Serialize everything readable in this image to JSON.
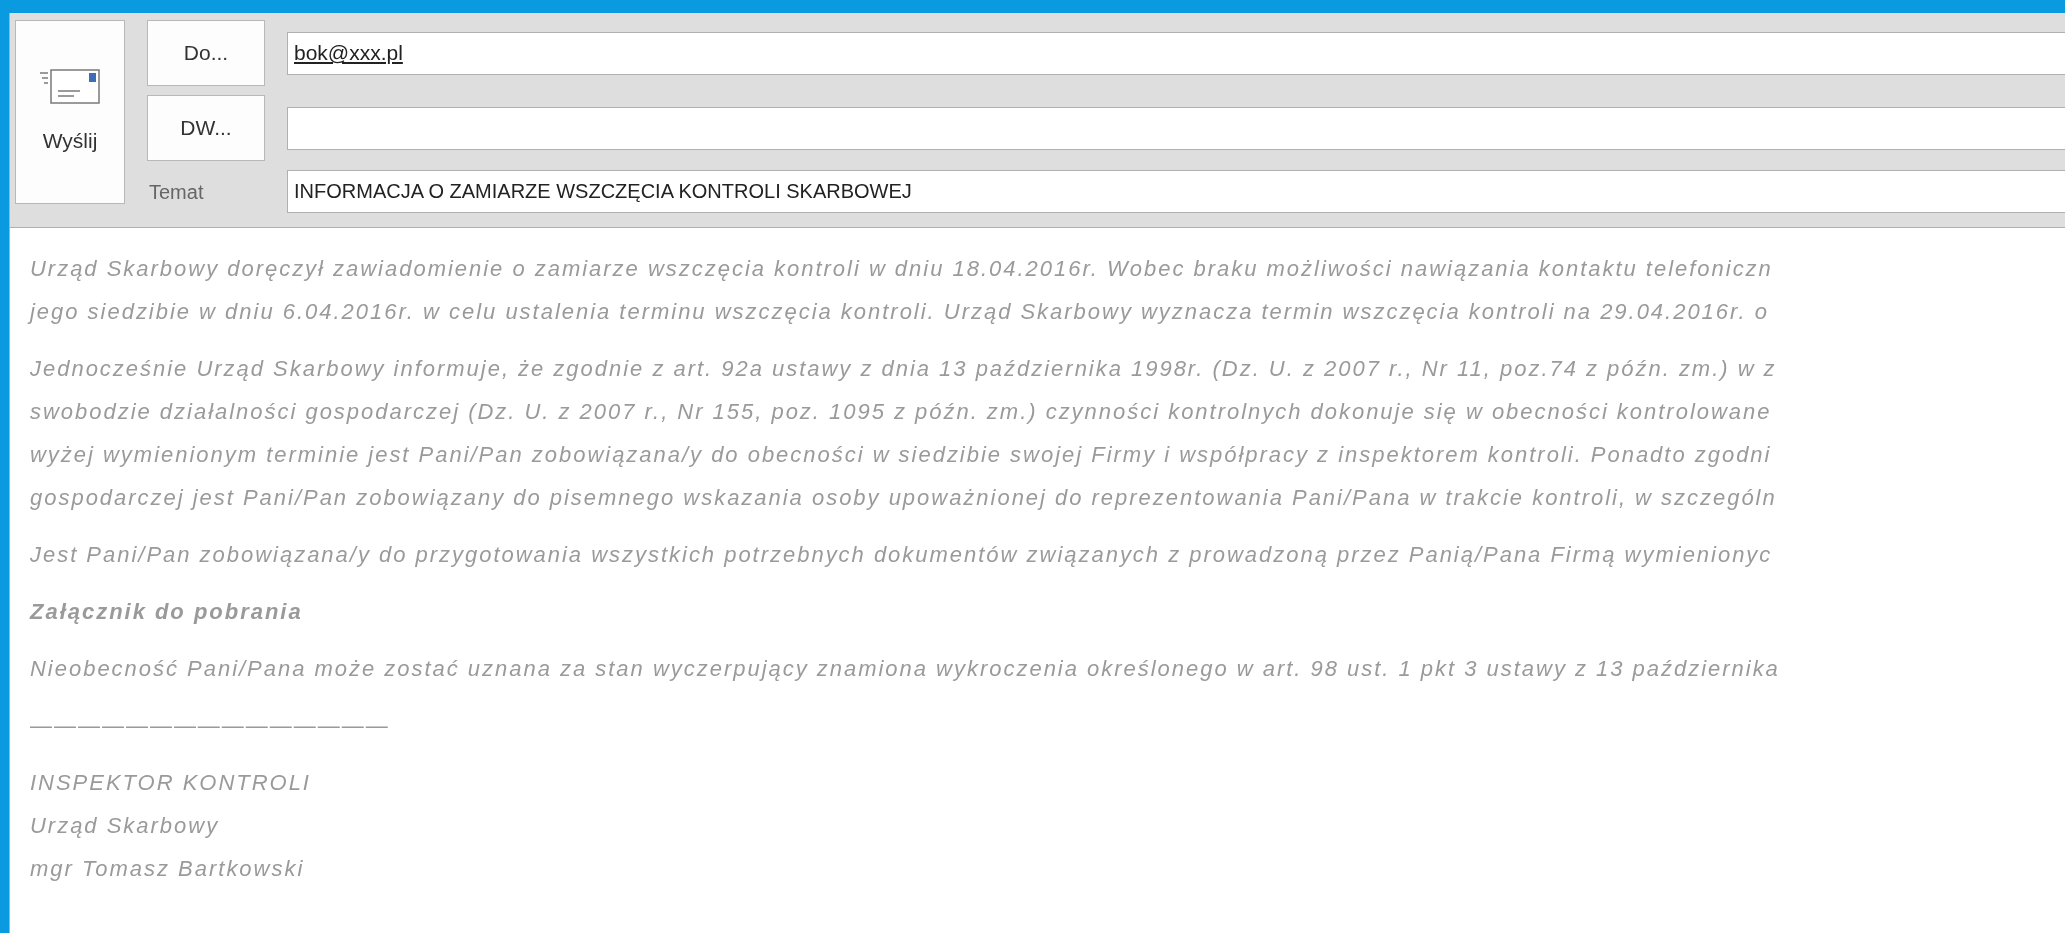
{
  "send_button": {
    "label": "Wyślij"
  },
  "to": {
    "label": "Do...",
    "value": "bok@xxx.pl"
  },
  "cc": {
    "label": "DW..."
  },
  "subject": {
    "label": "Temat",
    "value": "INFORMACJA O ZAMIARZE WSZCZĘCIA KONTROLI SKARBOWEJ"
  },
  "body": [
    {
      "kind": "paragraph",
      "lines": [
        "Urząd Skarbowy doręczył zawiadomienie o zamiarze wszczęcia kontroli w dniu 18.04.2016r. Wobec braku możliwości nawiązania kontaktu telefoniczn",
        "jego siedzibie w dniu 6.04.2016r. w celu ustalenia terminu wszczęcia kontroli. Urząd Skarbowy wyznacza termin wszczęcia kontroli na 29.04.2016r. o"
      ]
    },
    {
      "kind": "paragraph",
      "lines": [
        "Jednocześnie Urząd Skarbowy informuje, że zgodnie z art. 92a ustawy z dnia 13 października 1998r. (Dz. U. z 2007 r., Nr 11, poz.74 z późn. zm.) w z",
        "swobodzie działalności gospodarczej (Dz. U. z 2007 r., Nr 155, poz. 1095 z późn. zm.) czynności kontrolnych dokonuje się w obecności kontrolowane",
        "wyżej wymienionym terminie jest Pani/Pan zobowiązana/y do obecności w siedzibie swojej Firmy i współpracy z inspektorem kontroli. Ponadto zgodni",
        "gospodarczej jest Pani/Pan zobowiązany do pisemnego wskazania osoby upoważnionej do reprezentowania Pani/Pana w trakcie kontroli, w szczególn"
      ]
    },
    {
      "kind": "paragraph",
      "lines": [
        "Jest Pani/Pan zobowiązana/y do przygotowania wszystkich potrzebnych dokumentów związanych z prowadzoną przez Panią/Pana Firmą wymienionyc"
      ]
    },
    {
      "kind": "heading",
      "lines": [
        "Załącznik do pobrania"
      ]
    },
    {
      "kind": "paragraph",
      "lines": [
        "Nieobecność Pani/Pana może zostać uznana za stan wyczerpujący znamiona wykroczenia określonego w art. 98 ust. 1 pkt 3 ustawy z 13 października"
      ]
    },
    {
      "kind": "rule",
      "lines": [
        "———————————————"
      ]
    },
    {
      "kind": "signature",
      "lines": [
        "INSPEKTOR KONTROLI",
        "Urząd Skarbowy",
        "mgr Tomasz Bartkowski"
      ]
    }
  ]
}
